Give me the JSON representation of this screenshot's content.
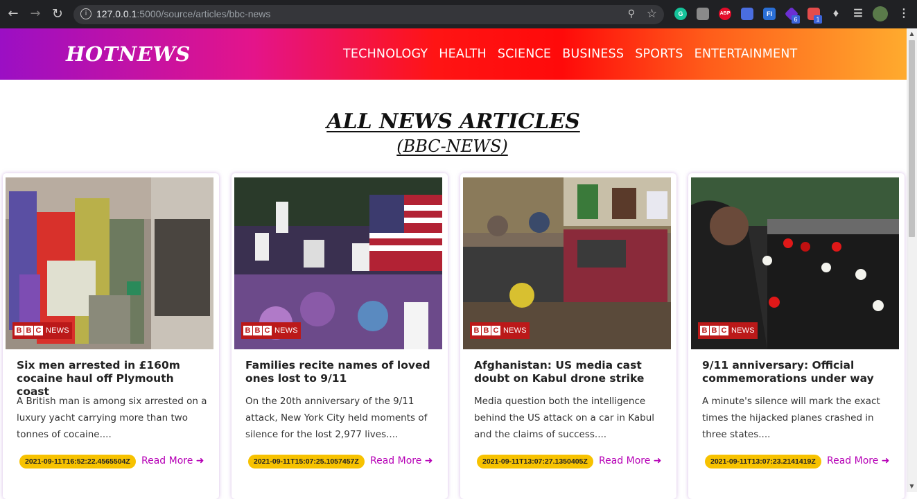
{
  "browser": {
    "url_host": "127.0.0.1",
    "url_rest": ":5000/source/articles/bbc-news",
    "extensions": [
      {
        "name": "grammarly-icon",
        "label": "G",
        "color": "#15c39a"
      },
      {
        "name": "extension-page-icon",
        "label": "",
        "color": "#8a8a8a"
      },
      {
        "name": "adblock-plus-icon",
        "label": "ABP",
        "color": "#e40d2b"
      },
      {
        "name": "zoom-icon",
        "label": "",
        "color": "#4a6ee0"
      },
      {
        "name": "fi-extension-icon",
        "label": "FI",
        "color": "#2a6fd6"
      },
      {
        "name": "purple-extension-icon",
        "label": "",
        "color": "#6b2fd3",
        "badge": "6"
      },
      {
        "name": "red-extension-icon",
        "label": "",
        "color": "#e34c4c",
        "badge": "1"
      }
    ]
  },
  "site": {
    "logo": "HOTNEWS",
    "menu": [
      "TECHNOLOGY",
      "HEALTH",
      "SCIENCE",
      "BUSINESS",
      "SPORTS",
      "ENTERTAINMENT"
    ]
  },
  "page": {
    "title": "ALL NEWS ARTICLES",
    "subtitle": "(BBC-NEWS)"
  },
  "articles": [
    {
      "title": "Six men arrested in £160m cocaine haul off Plymouth coast",
      "description": "A British man is among six arrested on a luxury yacht carrying more than two tonnes of cocaine....",
      "published": "2021-09-11T16:52:22.4565504Z",
      "read_more": "Read More",
      "source_badge": "NEWS"
    },
    {
      "title": "Families recite names of loved ones lost to 9/11",
      "description": "On the 20th anniversary of the 9/11 attack, New York City held moments of silence for the lost 2,977 lives....",
      "published": "2021-09-11T15:07:25.1057457Z",
      "read_more": "Read More",
      "source_badge": "NEWS"
    },
    {
      "title": "Afghanistan: US media cast doubt on Kabul drone strike",
      "description": "Media question both the intelligence behind the US attack on a car in Kabul and the claims of success....",
      "published": "2021-09-11T13:07:27.1350405Z",
      "read_more": "Read More",
      "source_badge": "NEWS"
    },
    {
      "title": "9/11 anniversary: Official commemorations under way",
      "description": "A minute's silence will mark the exact times the hijacked planes crashed in three states....",
      "published": "2021-09-11T13:07:23.2141419Z",
      "read_more": "Read More",
      "source_badge": "NEWS"
    }
  ],
  "colors": {
    "accent_link": "#b600b6",
    "date_badge": "#f7c200",
    "bbc_red": "#bb1919"
  }
}
